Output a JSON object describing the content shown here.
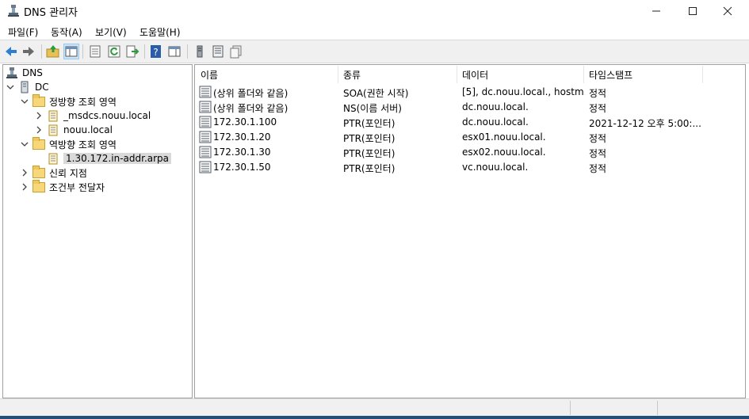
{
  "window": {
    "title": "DNS 관리자"
  },
  "menu": [
    "파일(F)",
    "동작(A)",
    "보기(V)",
    "도움말(H)"
  ],
  "toolbar": {
    "buttons": [
      "back-icon",
      "forward-icon",
      "up-folder-icon",
      "show-hide-tree-icon",
      "properties-icon",
      "refresh-icon",
      "export-list-icon",
      "help-icon",
      "action-pane-icon",
      "server-icon",
      "zone-list-icon",
      "record-icon"
    ]
  },
  "tree": {
    "root": "DNS",
    "server": "DC",
    "forward_zones": "정방향 조회 영역",
    "forward_children": [
      "_msdcs.nouu.local",
      "nouu.local"
    ],
    "reverse_zones": "역방향 조회 영역",
    "reverse_children": [
      "1.30.172.in-addr.arpa"
    ],
    "trust_points": "신뢰 지점",
    "conditional_forwarders": "조건부 전달자"
  },
  "list": {
    "columns": [
      "이름",
      "종류",
      "데이터",
      "타임스탬프"
    ],
    "rows": [
      {
        "name": "(상위 폴더와 같음)",
        "type": "SOA(권한 시작)",
        "data": "[5], dc.nouu.local., hostm...",
        "timestamp": "정적"
      },
      {
        "name": "(상위 폴더와 같음)",
        "type": "NS(이름 서버)",
        "data": "dc.nouu.local.",
        "timestamp": "정적"
      },
      {
        "name": "172.30.1.100",
        "type": "PTR(포인터)",
        "data": "dc.nouu.local.",
        "timestamp": "2021-12-12 오후 5:00:..."
      },
      {
        "name": "172.30.1.20",
        "type": "PTR(포인터)",
        "data": "esx01.nouu.local.",
        "timestamp": "정적"
      },
      {
        "name": "172.30.1.30",
        "type": "PTR(포인터)",
        "data": "esx02.nouu.local.",
        "timestamp": "정적"
      },
      {
        "name": "172.30.1.50",
        "type": "PTR(포인터)",
        "data": "vc.nouu.local.",
        "timestamp": "정적"
      }
    ]
  },
  "colors": {
    "selection": "#d9d9d9",
    "toolbar_bg": "#f0f0f0",
    "border": "#a0a0a0",
    "taskbar_edge": "#1f4e79"
  }
}
